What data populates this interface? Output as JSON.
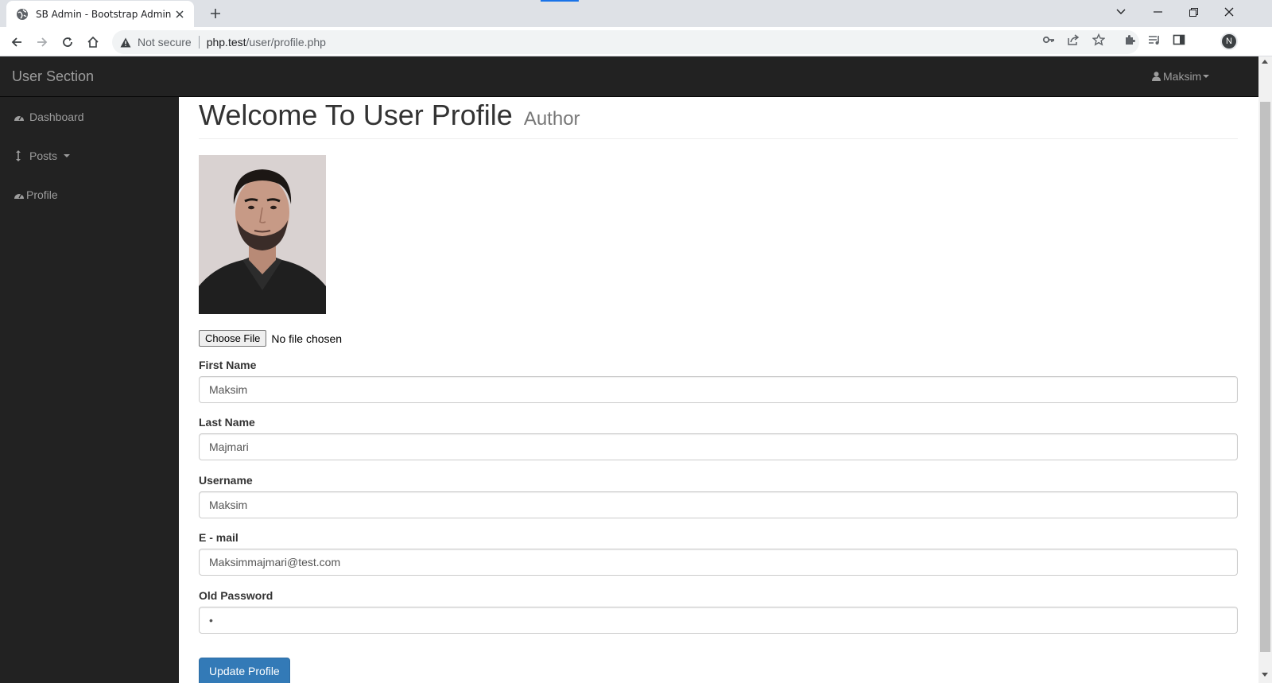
{
  "browser": {
    "tab_title": "SB Admin - Bootstrap Admin Ten",
    "security_label": "Not secure",
    "url_host": "php.test",
    "url_path": "/user/profile.php",
    "profile_initial": "N"
  },
  "navbar": {
    "brand": "User Section",
    "user_name": "Maksim"
  },
  "sidebar": {
    "items": [
      {
        "label": "Dashboard",
        "icon": "dashboard-icon"
      },
      {
        "label": "Posts",
        "icon": "arrows-v-icon"
      },
      {
        "label": "Profile",
        "icon": "dashboard-icon"
      }
    ]
  },
  "page": {
    "title": "Welcome To User Profile",
    "subtitle": "Author"
  },
  "form": {
    "file_button": "Choose File",
    "file_status": "No file chosen",
    "fields": [
      {
        "label": "First Name",
        "value": "Maksim"
      },
      {
        "label": "Last Name",
        "value": "Majmari"
      },
      {
        "label": "Username",
        "value": "Maksim"
      },
      {
        "label": "E - mail",
        "value": "Maksimmajmari@test.com"
      },
      {
        "label": "Old Password",
        "value": "•"
      }
    ],
    "submit_label": "Update Profile"
  },
  "colors": {
    "navbar_bg": "#222222",
    "primary": "#337ab7"
  }
}
